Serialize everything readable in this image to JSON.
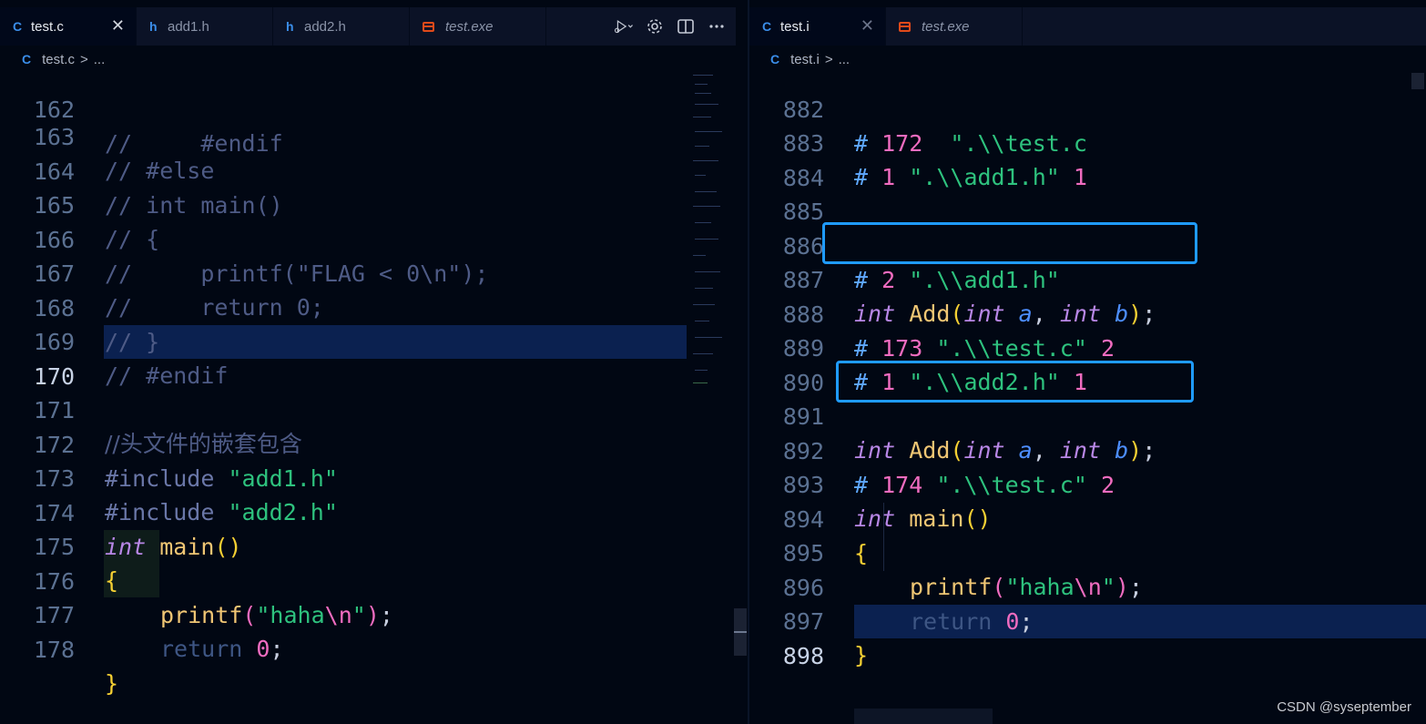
{
  "left_pane": {
    "tabs": [
      {
        "icon": "C",
        "label": "test.c",
        "close": "✕"
      },
      {
        "icon": "h",
        "label": "add1.h"
      },
      {
        "icon": "h",
        "label": "add2.h"
      },
      {
        "icon": "exe",
        "label": "test.exe"
      }
    ],
    "breadcrumb": {
      "icon": "C",
      "file": "test.c",
      "sep": ">",
      "more": "..."
    },
    "line_numbers": [
      "162",
      "163",
      "164",
      "165",
      "166",
      "167",
      "168",
      "169",
      "170",
      "171",
      "172",
      "173",
      "174",
      "175",
      "176",
      "177",
      "178"
    ],
    "lines": {
      "l162": "//     #endif",
      "l163": "// #else",
      "l164": "// int main()",
      "l165": "// {",
      "l166": "//     printf(\"FLAG < 0\\n\");",
      "l167": "//     return 0;",
      "l168": "// }",
      "l169": "// #endif",
      "l171": "//头文件的嵌套包含",
      "inc": "#include",
      "add1": "\"add1.h\"",
      "add2": "\"add2.h\"",
      "int": "int",
      "main": "main",
      "lp": "(",
      "rp": ")",
      "lbrace": "{",
      "rbrace": "}",
      "printf": "printf",
      "q1": "\"haha",
      "esc": "\\n",
      "q2": "\"",
      "semi": ";",
      "return": "return",
      "zero": "0"
    }
  },
  "right_pane": {
    "tabs": [
      {
        "icon": "C",
        "label": "test.i",
        "close": "✕"
      },
      {
        "icon": "exe",
        "label": "test.exe"
      }
    ],
    "breadcrumb": {
      "icon": "C",
      "file": "test.i",
      "sep": ">",
      "more": "..."
    },
    "line_numbers": [
      "882",
      "883",
      "884",
      "885",
      "886",
      "887",
      "888",
      "889",
      "890",
      "891",
      "892",
      "893",
      "894",
      "895",
      "896",
      "897",
      "898"
    ],
    "lines": {
      "hash": "#",
      "n172": "172",
      "n1": "1",
      "n2": "2",
      "n173": "173",
      "n174": "174",
      "s_test": "\".\\\\test.c\"",
      "s_test_partial": "\".\\\\test.c",
      "s_add1": "\".\\\\add1.h\"",
      "s_add2": "\".\\\\add2.h\"",
      "flag1": "1",
      "flag2": "2",
      "int": "int",
      "add": "Add",
      "a": "a",
      "b": "b",
      "comma": ",",
      "lp": "(",
      "rp": ")",
      "semi": ";",
      "main": "main",
      "lbrace": "{",
      "rbrace": "}",
      "printf": "printf",
      "q1": "\"haha",
      "esc": "\\n",
      "q2": "\"",
      "return": "return",
      "zero": "0"
    }
  },
  "colors": {
    "highlight_box": "#1f9bff",
    "background": "#010713",
    "current_line": "#0b2150"
  },
  "watermark": "CSDN @syseptember"
}
